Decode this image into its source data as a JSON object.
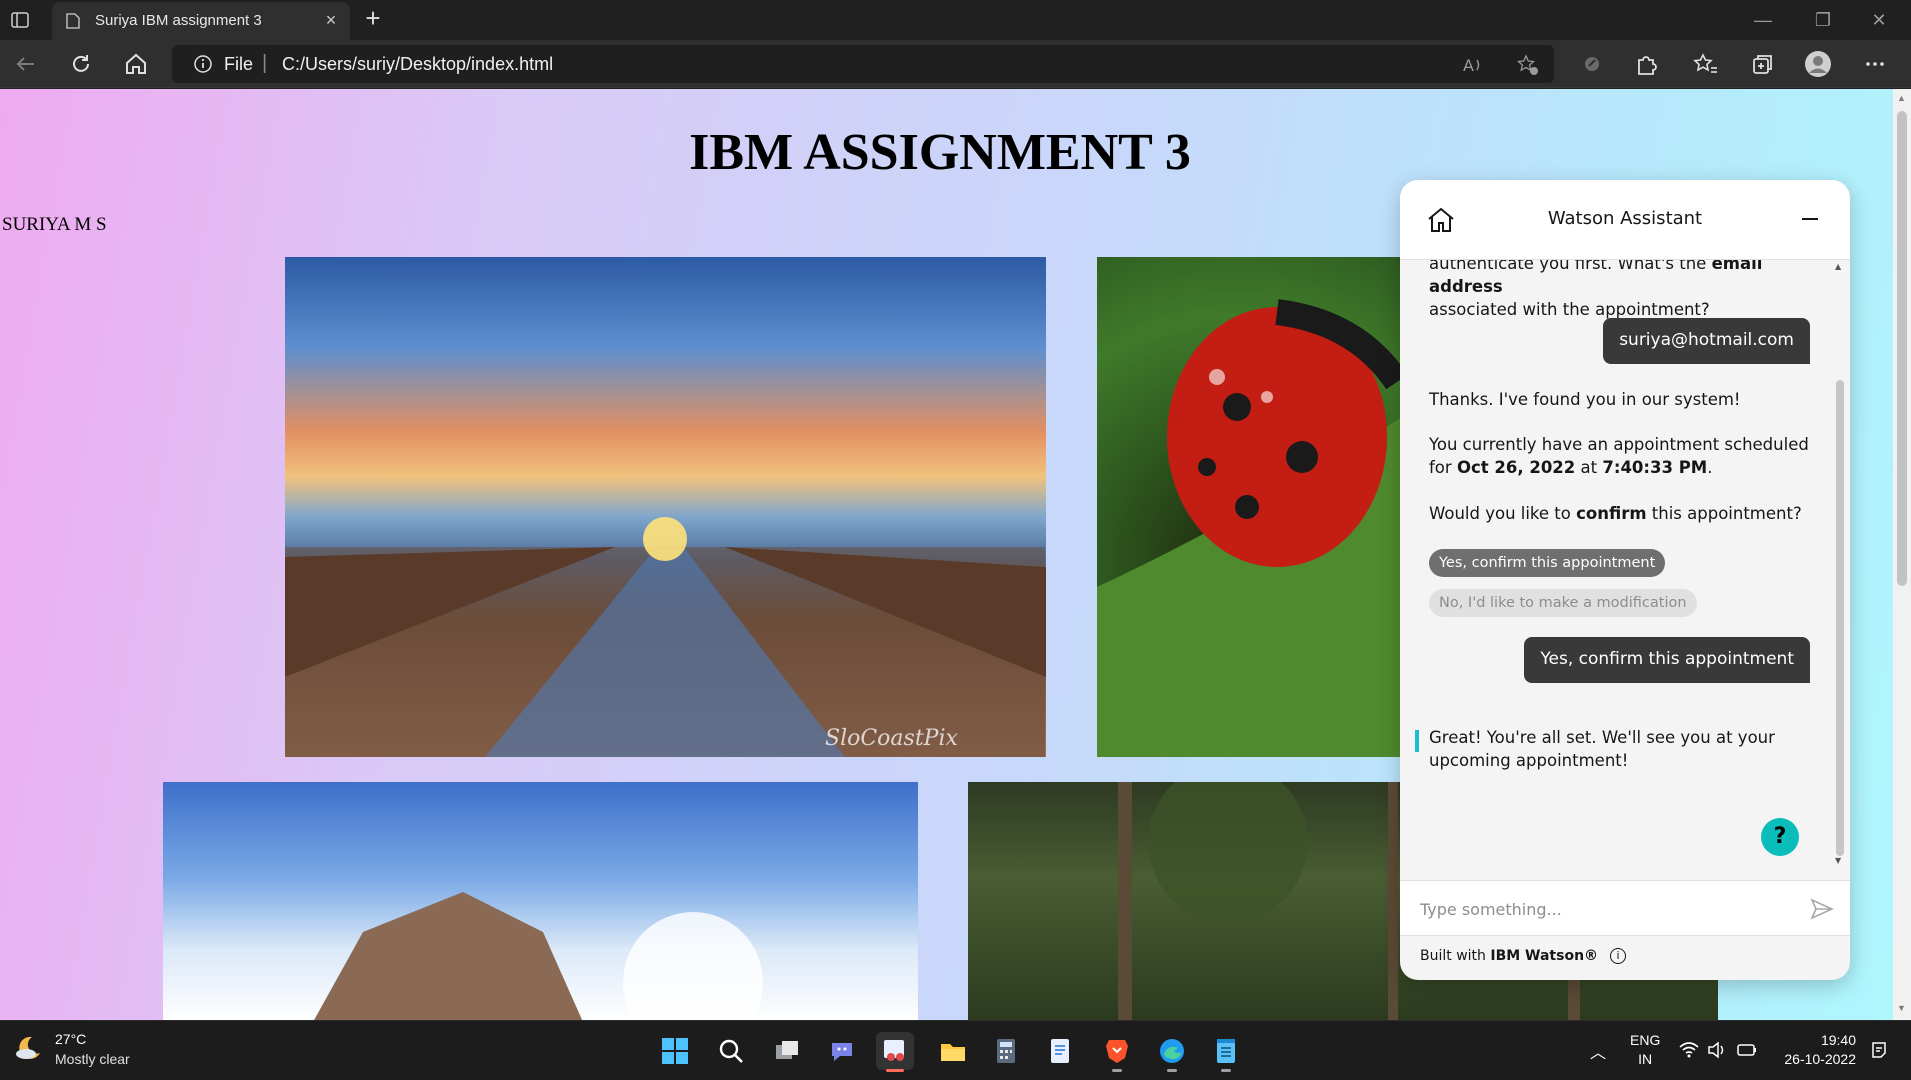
{
  "browser": {
    "tab_title": "Suriya IBM assignment 3",
    "address_prefix": "File",
    "address_url": "C:/Users/suriy/Desktop/index.html"
  },
  "page": {
    "heading": "IBM ASSIGNMENT 3",
    "author": "SURIYA M S",
    "images": [
      {
        "name": "pier-sunset-image",
        "watermark": "SloCoastPix"
      },
      {
        "name": "ladybug-image"
      },
      {
        "name": "birds-sky-image"
      },
      {
        "name": "forest-image"
      }
    ]
  },
  "watson": {
    "title": "Watson Assistant",
    "messages": {
      "auth_line1_pre": "authenticate you first. What's the ",
      "auth_line1_bold": "email address",
      "auth_line2": "associated with the appointment?",
      "user_email": "suriya@hotmail.com",
      "found": "Thanks. I've found you in our system!",
      "sched_pre": "You currently have an appointment scheduled",
      "sched_for": "for ",
      "sched_date": "Oct 26, 2022",
      "sched_at": " at ",
      "sched_time": "7:40:33 PM",
      "sched_dot": ".",
      "ask_pre": "Would you like to ",
      "ask_bold": "confirm",
      "ask_post": " this appointment?",
      "option_confirm": "Yes, confirm this appointment",
      "option_modify": "No, I'd like to make a modification",
      "user_reply": "Yes, confirm this appointment",
      "final_line1": "Great! You're all set. We'll see you at your",
      "final_line2": "upcoming appointment!"
    },
    "help_label": "?",
    "input_placeholder": "Type something...",
    "footer_pre": "Built with ",
    "footer_brand": "IBM Watson®",
    "info_label": "i"
  },
  "taskbar": {
    "weather_temp": "27°C",
    "weather_desc": "Mostly clear",
    "lang_line1": "ENG",
    "lang_line2": "IN",
    "time": "19:40",
    "date": "26-10-2022"
  },
  "colors": {
    "page_gradient_start": "#efaaf0",
    "page_gradient_end": "#aff6fd",
    "watson_accent": "#08bdba",
    "bubble_dark": "#393939"
  }
}
